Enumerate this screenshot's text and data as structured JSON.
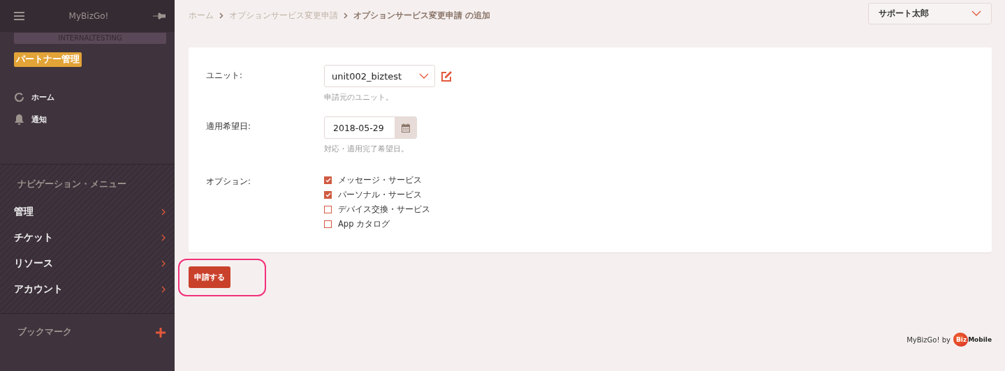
{
  "sidebar": {
    "title": "MyBizGo!",
    "environment": "INTERNALTESTING",
    "role_badge": "パートナー管理",
    "quick_links": [
      {
        "label": "ホーム",
        "kind": "home"
      },
      {
        "label": "通知",
        "kind": "bell"
      }
    ],
    "nav_heading": "ナビゲーション・メニュー",
    "nav_items": [
      {
        "label": "管理"
      },
      {
        "label": "チケット"
      },
      {
        "label": "リソース"
      },
      {
        "label": "アカウント"
      }
    ],
    "bookmarks_heading": "ブックマーク"
  },
  "breadcrumb": [
    {
      "label": "ホーム",
      "current": false
    },
    {
      "label": "オプションサービス変更申請",
      "current": false
    },
    {
      "label": "オプションサービス変更申請 の追加",
      "current": true
    }
  ],
  "user_menu": {
    "label": "サポート太郎"
  },
  "form": {
    "unit": {
      "label": "ユニット:",
      "value": "unit002_biztest",
      "help": "申請元のユニット。"
    },
    "date": {
      "label": "適用希望日:",
      "value": "2018-05-29",
      "help": "対応・適用完了希望日。"
    },
    "options": {
      "label": "オプション:",
      "items": [
        {
          "label": "メッセージ・サービス",
          "checked": true
        },
        {
          "label": "パーソナル・サービス",
          "checked": true
        },
        {
          "label": "デバイス交換・サービス",
          "checked": false
        },
        {
          "label": "App カタログ",
          "checked": false
        }
      ]
    }
  },
  "submit_button": {
    "label": "申請する",
    "highlighted": true
  },
  "footer": {
    "text": "MyBizGo! by",
    "logo_mark": "Biz",
    "logo_text": "Mobile"
  }
}
